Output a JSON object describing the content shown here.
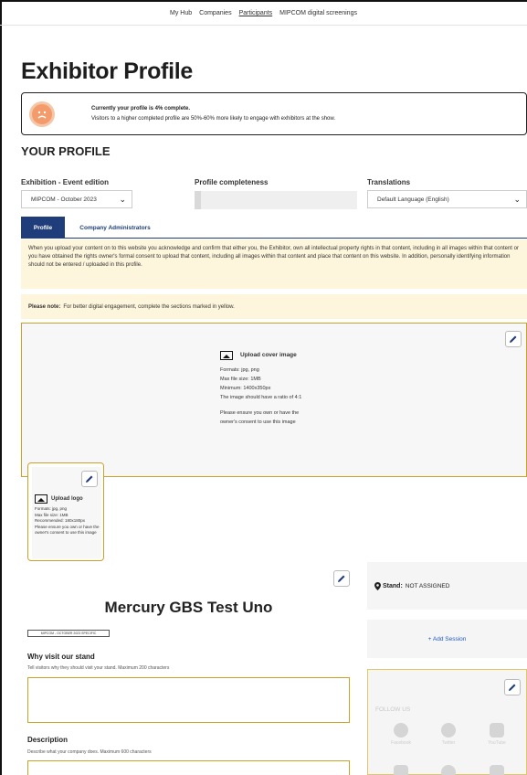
{
  "topnav": {
    "items": [
      "My Hub",
      "Companies",
      "Participants",
      "MIPCOM digital screenings"
    ],
    "active_index": 2
  },
  "page": {
    "title": "Exhibitor Profile"
  },
  "banner": {
    "line1": "Currently your profile is 4% complete.",
    "line2": "Visitors to a higher completed profile are 50%-60% more likely to engage with exhibitors at the show.",
    "face_icon": "sad-face-icon",
    "face_color": "#f39b6b"
  },
  "profile": {
    "section_title": "YOUR PROFILE",
    "exhibition_label": "Exhibition - Event edition",
    "exhibition_value": "MIPCOM - October 2023",
    "completeness_label": "Profile completeness",
    "completeness_value": 0.04,
    "translations_label": "Translations",
    "translations_value": "Default Language (English)"
  },
  "tabs": [
    {
      "label": "Profile",
      "active": true
    },
    {
      "label": "Company Administrators",
      "active": false
    }
  ],
  "notice": {
    "text": "When you upload your content on to this website you acknowledge and confirm that either you, the Exhibitor, own all intellectual property rights in that content, including in all images within that content or you have obtained the rights owner's formal consent to upload that content, including all images within that content and place that content on this website. In addition, personally identifying information should not be entered / uploaded in this profile."
  },
  "note": {
    "bold": "Please note:",
    "text": "For better digital engagement, complete the sections marked in yellow."
  },
  "cover": {
    "title": "Upload cover image",
    "formats": "Formats: jpg, png",
    "max_size": "Max file size: 1MB",
    "minimum": "Minimum: 1400x350px",
    "ratio": "The image should have a ratio of 4:1",
    "consent1": "Please ensure you own or have the",
    "consent2": "owner's consent to use this image"
  },
  "logo": {
    "title": "Upload logo",
    "formats": "Formats: jpg, png",
    "max_size": "Max file size: 1MB",
    "recommended": "Recommended: 180x180px",
    "consent": "Please ensure you own or have the owner's consent to use this image"
  },
  "company": {
    "name": "Mercury GBS Test Uno",
    "region_tag": "MIPCOM - OCTOBER 2023 SPECIFIC"
  },
  "why_visit": {
    "title": "Why visit our stand",
    "desc": "Tell visitors why they should visit your stand. Maximum 200 characters"
  },
  "description": {
    "title": "Description",
    "desc": "Describe what your company does. Maximum 600 characters"
  },
  "stand": {
    "label": "Stand:",
    "value": "NOT ASSIGNED"
  },
  "session": {
    "label": "+ Add Session"
  },
  "follow": {
    "title": "FOLLOW US",
    "networks": [
      "Facebook",
      "Twitter",
      "YouTube"
    ]
  },
  "colors": {
    "accent": "#1f3d7a",
    "highlight_border": "#c9a227",
    "notice_bg": "#fdf6dc"
  }
}
